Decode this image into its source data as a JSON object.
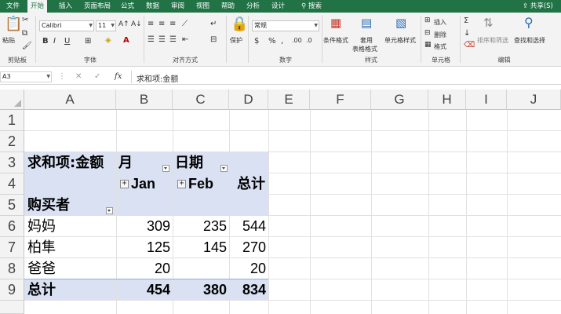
{
  "tabs": [
    "文件",
    "开始",
    "插入",
    "页面布局",
    "公式",
    "数据",
    "审阅",
    "视图",
    "帮助",
    "分析",
    "设计"
  ],
  "search_label": "搜索",
  "share_label": "共享(S)",
  "ribbon": {
    "paste": "粘贴",
    "clipboard": "剪贴板",
    "font_name": "Calibri",
    "font_size": "11",
    "font_group": "字体",
    "align_group": "对齐方式",
    "protect": "保护",
    "number_format": "常规",
    "number_group": "数字",
    "cond_format": "条件格式",
    "table_format_1": "套用",
    "table_format_2": "表格格式",
    "cell_style": "单元格样式",
    "style_group": "样式",
    "insert": "插入",
    "delete": "删除",
    "format": "格式",
    "cells_group": "单元格",
    "sort_filter": "排序和筛选",
    "find_select": "查找和选择",
    "edit_group": "编辑"
  },
  "formula_bar": {
    "name_box": "A3",
    "fx": "fx",
    "content": "求和项:金额"
  },
  "columns": [
    "A",
    "B",
    "C",
    "D",
    "E",
    "F",
    "G",
    "H",
    "I",
    "J"
  ],
  "rows": [
    "1",
    "2",
    "3",
    "4",
    "5",
    "6",
    "7",
    "8",
    "9"
  ],
  "pivot": {
    "value_label": "求和项:金额",
    "month_label": "月",
    "date_label": "日期",
    "col_jan": "Jan",
    "col_feb": "Feb",
    "grand_total_col": "总计",
    "row_field": "购买者",
    "rows": [
      {
        "name": "妈妈",
        "jan": "309",
        "feb": "235",
        "total": "544"
      },
      {
        "name": "柏隼",
        "jan": "125",
        "feb": "145",
        "total": "270"
      },
      {
        "name": "爸爸",
        "jan": "20",
        "feb": "",
        "total": "20"
      }
    ],
    "total_label": "总计",
    "total_jan": "454",
    "total_feb": "380",
    "total_all": "834"
  },
  "colors": {
    "brand": "#217346",
    "pivot_header": "#d9e1f2"
  }
}
